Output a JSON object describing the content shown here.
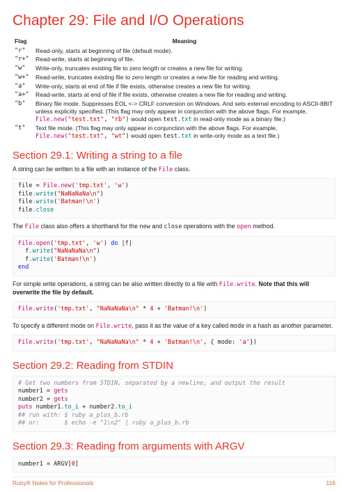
{
  "chapter_title": "Chapter 29: File and I/O Operations",
  "table": {
    "head_flag": "Flag",
    "head_meaning": "Meaning"
  },
  "flags": [
    {
      "flag": "\"r\"",
      "text": "Read-only, starts at beginning of file (default mode)."
    },
    {
      "flag": "\"r+\"",
      "text": "Read-write, starts at beginning of file."
    },
    {
      "flag": "\"w\"",
      "text": "Write-only, truncates existing file to zero length or creates a new file for writing."
    },
    {
      "flag": "\"w+\"",
      "text": "Read-write, truncates existing file to zero length or creates a new file for reading and writing."
    },
    {
      "flag": "\"a\"",
      "text": "Write-only, starts at end of file if file exists, otherwise creates a new file for writing."
    },
    {
      "flag": "\"a+\"",
      "text": "Read-write, starts at end of file if file exists, otherwise creates a new file for reading and writing."
    }
  ],
  "flag_b": {
    "flag": "\"b\"",
    "pre": "Binary file mode. Suppresses EOL <-> CRLF conversion on Windows. And sets external encoding to ASCII-8BIT unless explicitly specified. (This flag may only appear in conjunction with the above flags. For example, ",
    "code_a": "File.new(",
    "code_b": "\"test.txt\"",
    "code_c": ", ",
    "code_d": "\"rb\"",
    "code_e": ")",
    "mid": " would open ",
    "tt": "test.txt",
    "post": " in read-only mode as a binary file.)"
  },
  "flag_t": {
    "flag": "\"t\"",
    "pre": "Text file mode. (This flag may only appear in conjunction with the above flags. For example, ",
    "code_a": "File.new(",
    "code_b": "\"test.txt\"",
    "code_c": ", ",
    "code_d": "\"wt\"",
    "code_e": ")",
    "mid": " would open ",
    "tt": "test.txt",
    "post": " in write-only mode as a text file.)"
  },
  "s1": {
    "title": "Section 29.1: Writing a string to a file",
    "p1_a": "A string can be written to a file with an instance of the ",
    "p1_b": "File",
    "p1_c": " class.",
    "p2_a": "The ",
    "p2_b": "File",
    "p2_c": " class also offers a shorthand for the ",
    "p2_d": "new",
    "p2_e": " and ",
    "p2_f": "close",
    "p2_g": " operations with the ",
    "p2_h": "open",
    "p2_i": " method.",
    "p3_a": "For simple write operations, a string can be also written directly to a file with ",
    "p3_b": "File.write",
    "p3_c": ". ",
    "p3_d": "Note that this will overwrite the file by default.",
    "p4_a": "To specify a different mode on ",
    "p4_b": "File.write",
    "p4_c": ", pass it as the value of a key called ",
    "p4_d": "mode",
    "p4_e": " in a hash as another parameter."
  },
  "s2_title": "Section 29.2: Reading from STDIN",
  "s3_title": "Section 29.3: Reading from arguments with ARGV",
  "footer_left": "Ruby® Notes for Professionals",
  "footer_right": "116"
}
